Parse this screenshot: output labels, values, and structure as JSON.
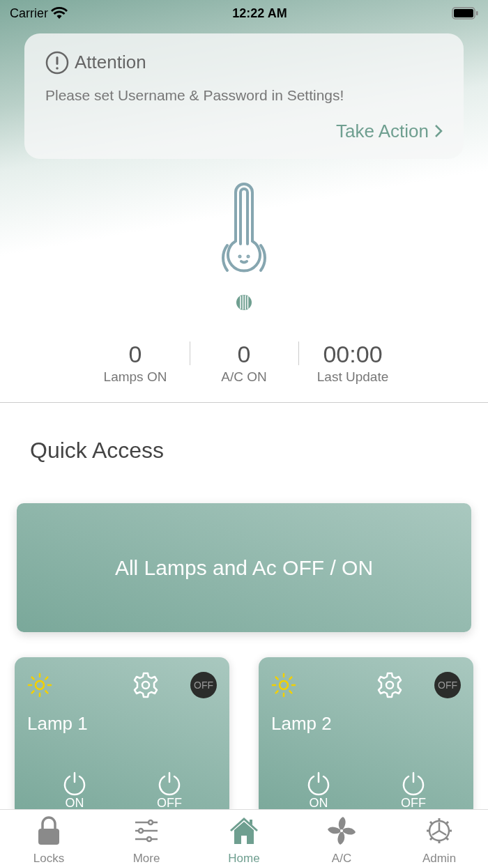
{
  "status_bar": {
    "carrier": "Carrier",
    "time": "12:22 AM"
  },
  "alert": {
    "title": "Attention",
    "message": "Please set Username & Password in Settings!",
    "action": "Take Action"
  },
  "stats": [
    {
      "value": "0",
      "label": "Lamps ON"
    },
    {
      "value": "0",
      "label": "A/C ON"
    },
    {
      "value": "00:00",
      "label": "Last Update"
    }
  ],
  "quick_access": {
    "title": "Quick Access",
    "main_button": "All Lamps and Ac OFF / ON"
  },
  "lamps": [
    {
      "name": "Lamp 1",
      "state": "OFF",
      "on_label": "ON",
      "off_label": "OFF"
    },
    {
      "name": "Lamp 2",
      "state": "OFF",
      "on_label": "ON",
      "off_label": "OFF"
    }
  ],
  "tabs": [
    {
      "label": "Locks",
      "selected": false
    },
    {
      "label": "More",
      "selected": false
    },
    {
      "label": "Home",
      "selected": true
    },
    {
      "label": "A/C",
      "selected": false
    },
    {
      "label": "Admin",
      "selected": false
    }
  ]
}
